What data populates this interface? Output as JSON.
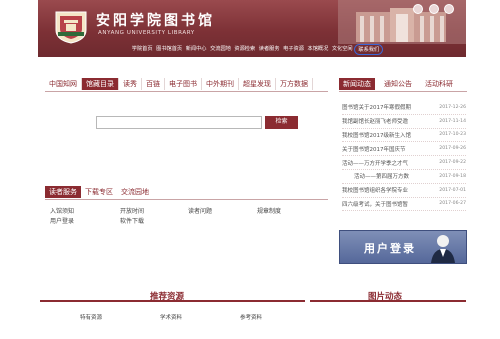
{
  "header": {
    "title": "安阳学院图书馆",
    "subtitle": "ANYANG UNIVERSITY LIBRARY",
    "nav": [
      "学院首页",
      "图书馆首页",
      "新闻中心",
      "交流园地",
      "资源检索",
      "读者服务",
      "电子资源",
      "本馆概况",
      "文化空间",
      "联系我们"
    ]
  },
  "resources": {
    "tabs": [
      "中国知网",
      "馆藏目录",
      "读秀",
      "百链",
      "电子图书",
      "中外期刊",
      "超星发现",
      "万方数据"
    ],
    "active_tab": "馆藏目录",
    "search_placeholder": "",
    "search_button": "检索"
  },
  "services": {
    "tabs": [
      "读者服务",
      "下载专区",
      "交流园地"
    ],
    "links": [
      "入馆须知",
      "开放时间",
      "读者问题",
      "规章制度",
      "用户登录",
      "软件下载"
    ]
  },
  "news": {
    "tabs": [
      "新闻动态",
      "通知公告",
      "活动科研"
    ],
    "items": [
      {
        "title": "图书馆关于2017年寒假假期",
        "date": "2017-12-26"
      },
      {
        "title": "我馆副馆长赵丽飞老师受邀",
        "date": "2017-11-14"
      },
      {
        "title": "我校图书馆2017级新生入馆",
        "date": "2017-10-23"
      },
      {
        "title": "关于图书馆2017年国庆节",
        "date": "2017-09-26"
      },
      {
        "title": "活动——万方开学季之才气",
        "date": "2017-09-22"
      },
      {
        "title": "活动——第四届万方数",
        "date": "2017-09-18"
      },
      {
        "title": "我校图书馆组织各学院专业",
        "date": "2017-07-01"
      },
      {
        "title": "四六级考试，关于图书馆暂",
        "date": "2017-06-27"
      }
    ]
  },
  "login_banner": {
    "label": "用户登录"
  },
  "bottom": {
    "recommend_title": "推荐资源",
    "recommend_items": [
      "特有资源",
      "学术资料",
      "参考资料"
    ],
    "photo_title": "图片动态"
  }
}
